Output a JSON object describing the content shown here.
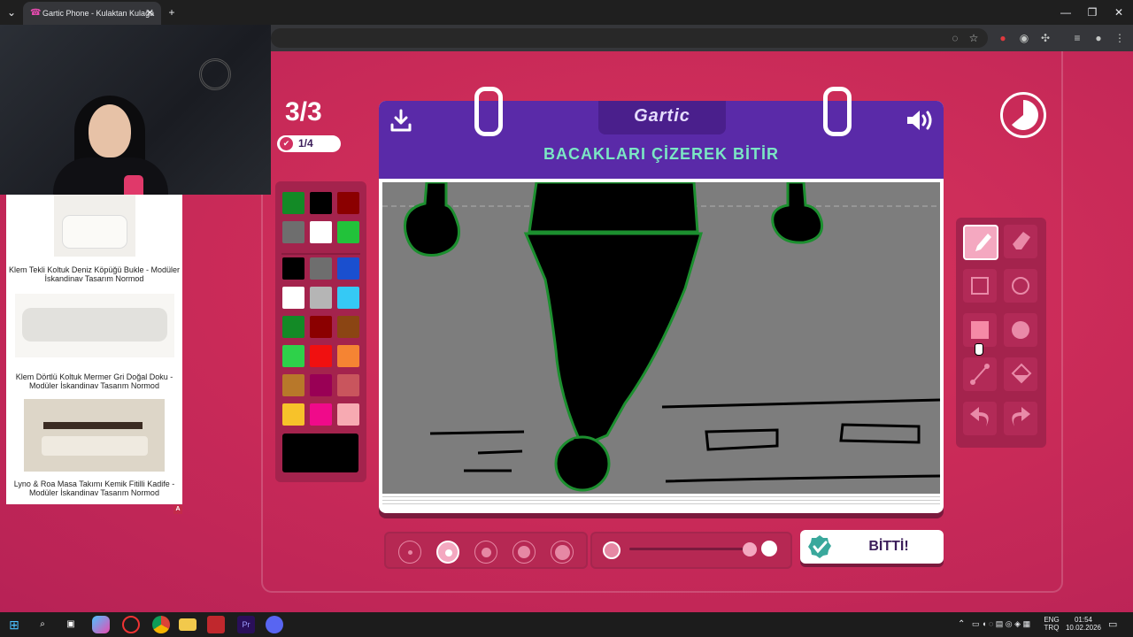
{
  "browser": {
    "tab_title": "Gartic Phone - Kulaktan Kulağa",
    "tab_close": "✕",
    "new_tab": "+",
    "window_controls": [
      "—",
      "❐",
      "✕"
    ]
  },
  "ad": {
    "products": [
      {
        "caption": "Klem Tekli Koltuk Deniz Köpüğü Bukle - Modüler İskandinav Tasarım Normod"
      },
      {
        "caption": "Klem Dörtlü Koltuk Mermer Gri Doğal Doku - Modüler İskandinav Tasarım Normod"
      },
      {
        "caption": "Lyno & Roa Masa Takımı Kemik Fitilli Kadife - Modüler İskandinav Tasarım Normod"
      }
    ],
    "badge": "A"
  },
  "game": {
    "round": "3/3",
    "votes": "1/4",
    "logo": "Gartic",
    "prompt": "BACAKLARI ÇİZEREK BİTİR",
    "done_label": "BİTTİ!",
    "palette_colors": [
      "#138a26",
      "#000000",
      "#8b0000",
      "#6e6e6e",
      "#ffffff",
      "#22c23a",
      "#000000",
      "#6e6e6e",
      "#1a4fcf",
      "#ffffff",
      "#b5b5b5",
      "#35c9f5",
      "#138a26",
      "#8b0000",
      "#8b4513",
      "#2ed14a",
      "#f01010",
      "#f58433",
      "#b8782a",
      "#990055",
      "#c9555d",
      "#f7c22a",
      "#f00a8a",
      "#f7aab2"
    ],
    "current_color": "#000000",
    "brush_sizes": [
      1,
      2,
      3,
      4,
      5
    ],
    "selected_brush": 2,
    "opacity": 1.0,
    "tools": [
      {
        "name": "pencil-tool",
        "icon": "pencil-icon",
        "active": true
      },
      {
        "name": "eraser-tool",
        "icon": "eraser-icon",
        "active": false
      },
      {
        "name": "rectangle-outline-tool",
        "icon": "square-outline-icon",
        "active": false
      },
      {
        "name": "ellipse-outline-tool",
        "icon": "circle-outline-icon",
        "active": false
      },
      {
        "name": "rectangle-fill-tool",
        "icon": "square-fill-icon",
        "active": false
      },
      {
        "name": "ellipse-fill-tool",
        "icon": "circle-fill-icon",
        "active": false
      },
      {
        "name": "line-tool",
        "icon": "line-icon",
        "active": false
      },
      {
        "name": "fill-bucket-tool",
        "icon": "bucket-icon",
        "active": false
      },
      {
        "name": "undo-tool",
        "icon": "undo-icon",
        "active": false
      },
      {
        "name": "redo-tool",
        "icon": "redo-icon",
        "active": false
      }
    ]
  },
  "taskbar": {
    "lang_top": "ENG",
    "lang_bottom": "TRQ",
    "time": "01:54",
    "date": "10.02.2026"
  }
}
